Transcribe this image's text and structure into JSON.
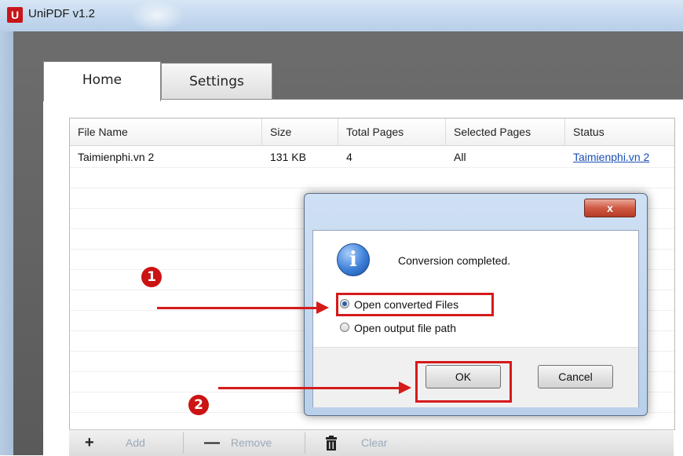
{
  "window": {
    "app_icon": "U",
    "title": "UniPDF v1.2"
  },
  "tabs": [
    {
      "label": "Home",
      "active": true
    },
    {
      "label": "Settings",
      "active": false
    }
  ],
  "file_table": {
    "columns": [
      "File Name",
      "Size",
      "Total Pages",
      "Selected Pages",
      "Status"
    ],
    "rows": [
      {
        "file_name": "Taimienphi.vn 2",
        "size": "131 KB",
        "total_pages": "4",
        "selected_pages": "All",
        "status": "Taimienphi.vn 2"
      }
    ]
  },
  "toolbar": {
    "add_icon": "+",
    "add_label": "Add",
    "remove_icon": "—",
    "remove_label": "Remove",
    "clear_icon": "trash-icon",
    "clear_label": "Clear"
  },
  "dialog": {
    "close_label": "x",
    "message": "Conversion completed.",
    "options": [
      {
        "label": "Open converted Files",
        "selected": true
      },
      {
        "label": "Open output file path",
        "selected": false
      }
    ],
    "ok_label": "OK",
    "cancel_label": "Cancel"
  },
  "annotations": {
    "step1": "1",
    "step2": "2",
    "color": "#d51a1a"
  }
}
